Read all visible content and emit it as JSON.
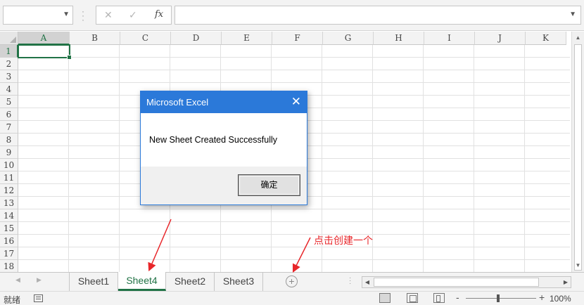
{
  "formula_bar": {
    "name_box": "",
    "cancel_glyph": "✕",
    "enter_glyph": "✓",
    "fx_label": "fx",
    "formula": ""
  },
  "grid": {
    "columns": [
      "A",
      "B",
      "C",
      "D",
      "E",
      "F",
      "G",
      "H",
      "I",
      "J",
      "K"
    ],
    "rows": [
      "1",
      "2",
      "3",
      "4",
      "5",
      "6",
      "7",
      "8",
      "9",
      "10",
      "11",
      "12",
      "13",
      "14",
      "15",
      "16",
      "17",
      "18"
    ],
    "selected_column": "A",
    "selected_row": "1"
  },
  "sheet_tabs": {
    "tabs": [
      "Sheet1",
      "Sheet4",
      "Sheet2",
      "Sheet3"
    ],
    "active": "Sheet4",
    "add_glyph": "+"
  },
  "status_bar": {
    "status": "就绪",
    "zoom_minus": "-",
    "zoom_plus": "+",
    "zoom_level": "100%"
  },
  "dialog": {
    "title": "Microsoft Excel",
    "message": "New Sheet Created Successfully",
    "ok_label": "确定",
    "close_glyph": "✕"
  },
  "annotation": {
    "text": "点击创建一个",
    "color": "#e8262a"
  },
  "colors": {
    "excel_green": "#217346",
    "dialog_blue": "#2b79d9"
  }
}
